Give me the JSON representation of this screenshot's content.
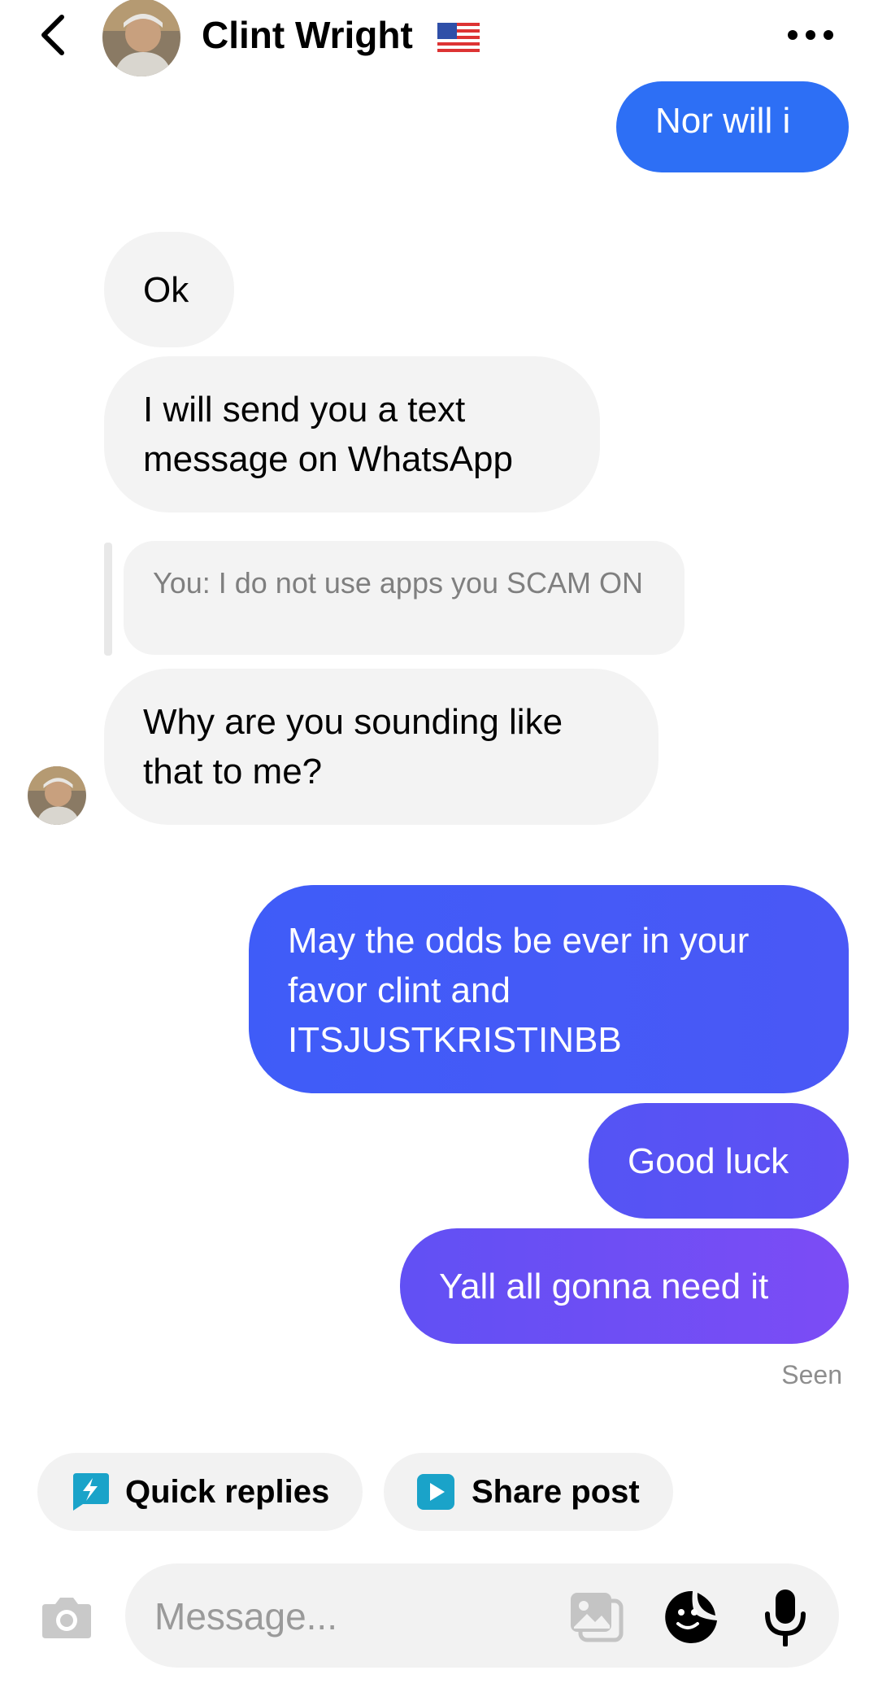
{
  "header": {
    "title": "Clint Wright",
    "flag_icon": "us-flag-icon",
    "back_icon": "chevron-left-icon",
    "more_icon": "more-horizontal-icon"
  },
  "messages": [
    {
      "from": "me",
      "text": "Nor will i"
    },
    {
      "from": "them",
      "text": "Ok"
    },
    {
      "from": "them",
      "text": "I will send you a text message on WhatsApp"
    },
    {
      "from": "them",
      "reply_to": "You: I do not use apps you SCAM ON",
      "text": "Why are you sounding like that to me?"
    },
    {
      "from": "me",
      "text": "May the odds be ever in your favor clint and ITSJUSTKRISTINBB"
    },
    {
      "from": "me",
      "text": "Good luck"
    },
    {
      "from": "me",
      "text": "Yall all gonna need it"
    }
  ],
  "status": {
    "seen": "Seen"
  },
  "quick_actions": {
    "quick_replies": "Quick replies",
    "share_post": "Share post"
  },
  "composer": {
    "placeholder": "Message..."
  },
  "colors": {
    "outgoing_gradient": [
      "#3f5cf8",
      "#7c4cf5"
    ],
    "incoming_bg": "#f3f3f3",
    "chip_icon": "#1aa3c9"
  }
}
